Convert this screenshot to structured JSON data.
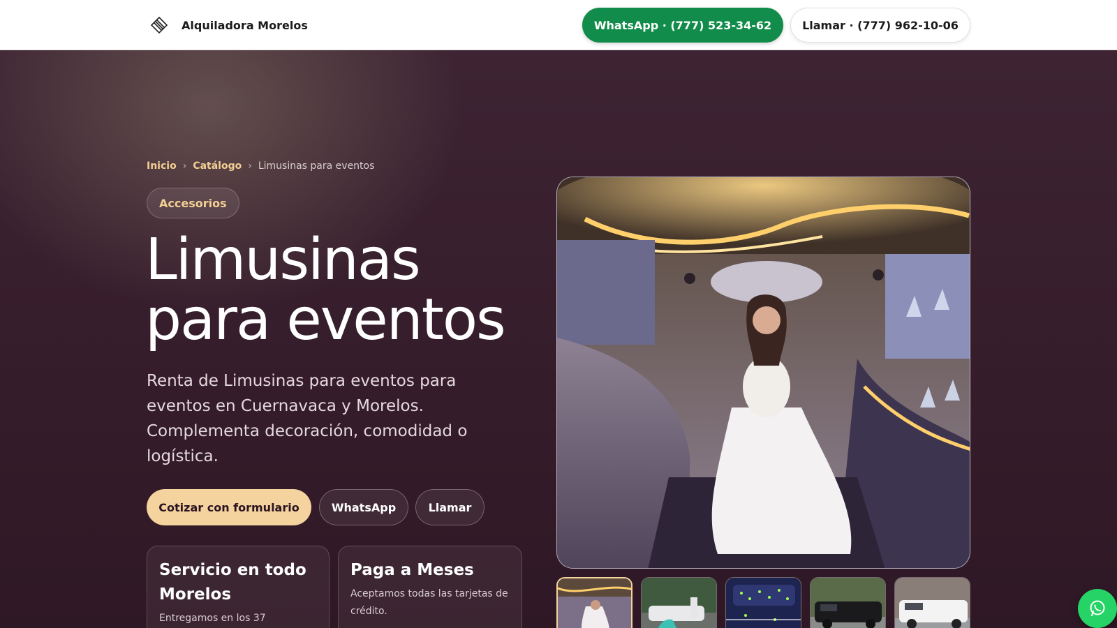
{
  "header": {
    "brand_name": "Alquiladora Morelos",
    "whatsapp_label": "WhatsApp · (777) 523-34-62",
    "call_label": "Llamar · (777) 962-10-06"
  },
  "breadcrumb": {
    "home": "Inicio",
    "catalog": "Catálogo",
    "current": "Limusinas para eventos",
    "separator": "›"
  },
  "category_pill": "Accesorios",
  "hero": {
    "title_line1": "Limusinas",
    "title_line2": "para eventos",
    "description": "Renta de Limusinas para eventos para eventos en Cuernavaca y Morelos. Complementa decoración, comodidad o logística."
  },
  "actions": {
    "quote_label": "Cotizar con formulario",
    "whatsapp_label": "WhatsApp",
    "call_label": "Llamar"
  },
  "features": [
    {
      "title": "Servicio en todo Morelos",
      "text": "Entregamos en los 37"
    },
    {
      "title": "Paga a Meses",
      "text": "Aceptamos todas las tarjetas de crédito."
    }
  ],
  "gallery": {
    "thumb_count": 5,
    "active_index": 0
  },
  "colors": {
    "accent": "#f5d39f",
    "whatsapp_green": "#128c4a",
    "fab_green": "#25d366",
    "hero_bg": "#3a1f2d"
  },
  "icons": {
    "brand": "diamond-lines-icon",
    "fab": "whatsapp-icon"
  }
}
